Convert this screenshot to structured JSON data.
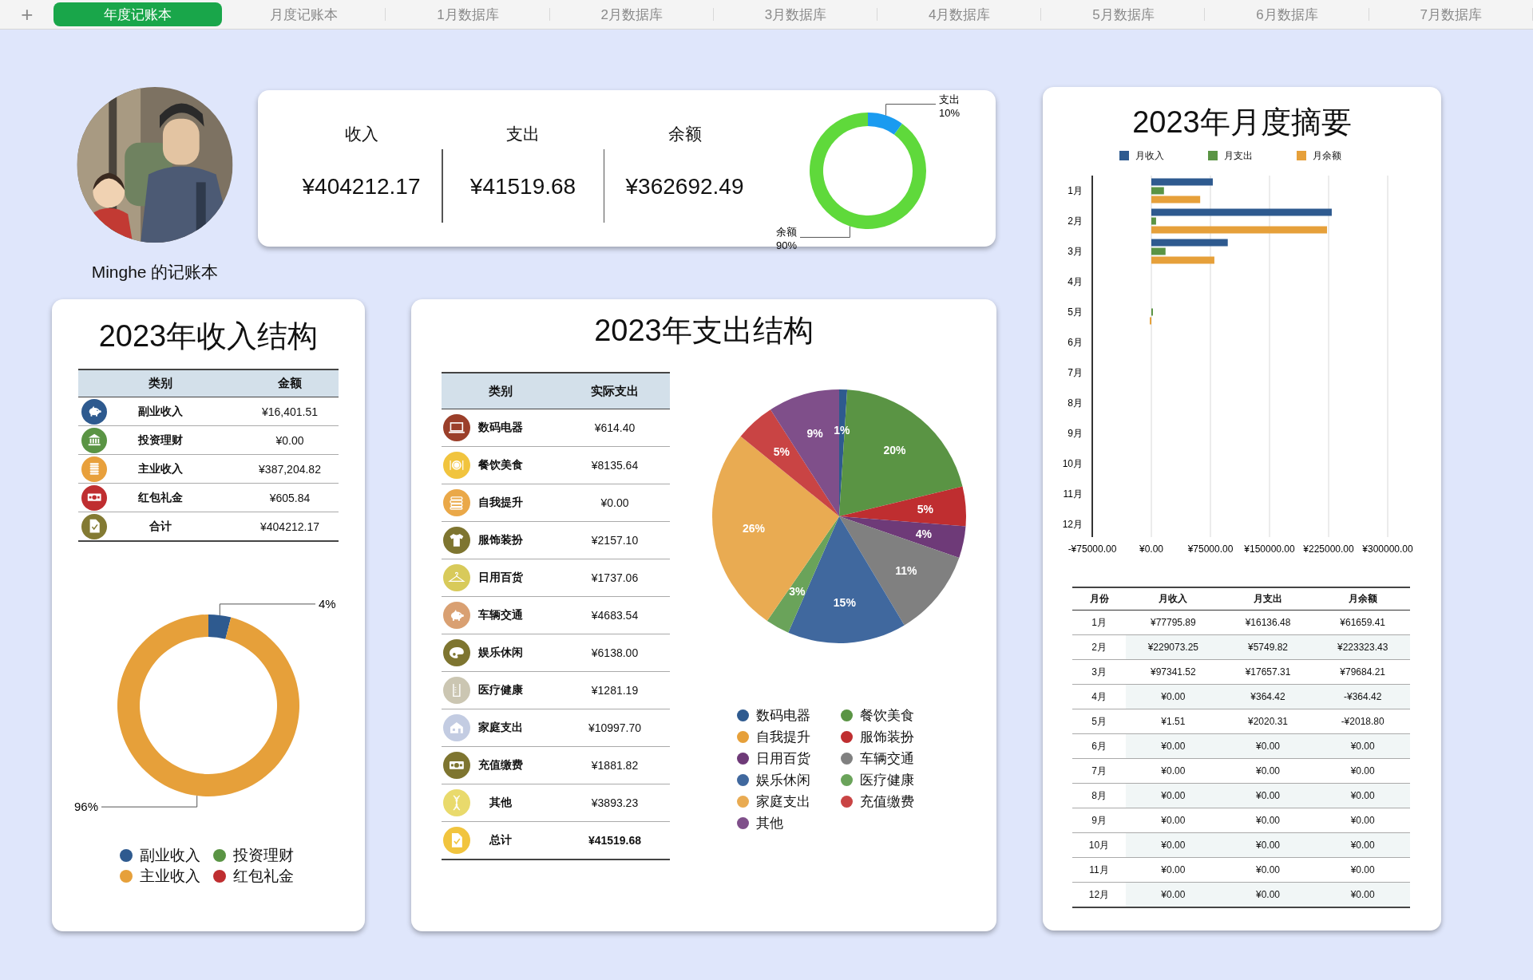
{
  "add_tab": "+",
  "tabs": [
    {
      "label": "年度记账本",
      "selected": true
    },
    {
      "label": "月度记账本",
      "selected": false
    },
    {
      "label": "1月数据库",
      "selected": false
    },
    {
      "label": "2月数据库",
      "selected": false
    },
    {
      "label": "3月数据库",
      "selected": false
    },
    {
      "label": "4月数据库",
      "selected": false
    },
    {
      "label": "5月数据库",
      "selected": false
    },
    {
      "label": "6月数据库",
      "selected": false
    },
    {
      "label": "7月数据库",
      "selected": false
    }
  ],
  "profile": {
    "name": "Minghe 的记账本"
  },
  "summary": {
    "stats": [
      {
        "label": "收入",
        "value": "¥404212.17"
      },
      {
        "label": "支出",
        "value": "¥41519.68"
      },
      {
        "label": "余额",
        "value": "¥362692.49"
      }
    ],
    "chart_data": {
      "type": "donut",
      "categories": [
        "支出",
        "余额"
      ],
      "values": [
        10,
        90
      ],
      "colors": [
        "#1a9bf0",
        "#5fd93b"
      ],
      "value_labels": [
        "10%",
        "90%"
      ]
    }
  },
  "income_structure": {
    "title": "2023年收入结构",
    "table": {
      "columns": [
        "类别",
        "金额"
      ],
      "rows": [
        {
          "category": "副业收入",
          "amount": "¥16,401.51",
          "color": "#2e5a8f"
        },
        {
          "category": "投资理财",
          "amount": "¥0.00",
          "color": "#5a9444"
        },
        {
          "category": "主业收入",
          "amount": "¥387,204.82",
          "color": "#e8a03c"
        },
        {
          "category": "红包礼金",
          "amount": "¥605.84",
          "color": "#bf2e30"
        }
      ],
      "total": {
        "category": "合计",
        "amount": "¥404212.17",
        "color": "#837a33"
      }
    },
    "chart_data": {
      "type": "donut",
      "values": [
        4,
        96
      ],
      "colors": [
        "#2e5a8f",
        "#e6a03a"
      ],
      "value_labels": [
        "4%",
        "96%"
      ]
    },
    "legend": [
      {
        "label": "副业收入",
        "color": "#2e5a8f"
      },
      {
        "label": "投资理财",
        "color": "#5a9444"
      },
      {
        "label": "主业收入",
        "color": "#e6a03a"
      },
      {
        "label": "红包礼金",
        "color": "#bf2e30"
      }
    ]
  },
  "expense_structure": {
    "title": "2023年支出结构",
    "table": {
      "columns": [
        "类别",
        "实际支出"
      ],
      "rows": [
        {
          "category": "数码电器",
          "amount": "¥614.40",
          "color": "#9b3f2a"
        },
        {
          "category": "餐饮美食",
          "amount": "¥8135.64",
          "color": "#f1c43e"
        },
        {
          "category": "自我提升",
          "amount": "¥0.00",
          "color": "#eaa848"
        },
        {
          "category": "服饰装扮",
          "amount": "¥2157.10",
          "color": "#7e7530"
        },
        {
          "category": "日用百货",
          "amount": "¥1737.06",
          "color": "#d8ca5a"
        },
        {
          "category": "车辆交通",
          "amount": "¥4683.54",
          "color": "#d9a072"
        },
        {
          "category": "娱乐休闲",
          "amount": "¥6138.00",
          "color": "#7e7530"
        },
        {
          "category": "医疗健康",
          "amount": "¥1281.19",
          "color": "#cbc6b2"
        },
        {
          "category": "家庭支出",
          "amount": "¥10997.70",
          "color": "#c3cce2"
        },
        {
          "category": "充值缴费",
          "amount": "¥1881.82",
          "color": "#7e7530"
        },
        {
          "category": "其他",
          "amount": "¥3893.23",
          "color": "#e9da6c"
        }
      ],
      "total": {
        "category": "总计",
        "amount": "¥41519.68",
        "color": "#f1c43e"
      }
    },
    "chart_data": {
      "type": "pie",
      "values": [
        1,
        20,
        5,
        4,
        11,
        15,
        3,
        26,
        5,
        9
      ],
      "colors": [
        "#2e5a8f",
        "#5a9444",
        "#bf2e30",
        "#6e3a78",
        "#808080",
        "#40689e",
        "#6aa35a",
        "#e9ab52",
        "#c94444",
        "#7f4f8a"
      ],
      "value_labels": [
        "1%",
        "20%",
        "5%",
        "4%",
        "11%",
        "15%",
        "3%",
        "26%",
        "5%",
        "9%"
      ]
    },
    "legend": [
      {
        "label": "数码电器",
        "color": "#2e5a8f"
      },
      {
        "label": "餐饮美食",
        "color": "#5a9444"
      },
      {
        "label": "自我提升",
        "color": "#e6a03a"
      },
      {
        "label": "服饰装扮",
        "color": "#bf2e30"
      },
      {
        "label": "日用百货",
        "color": "#6e3a78"
      },
      {
        "label": "车辆交通",
        "color": "#808080"
      },
      {
        "label": "娱乐休闲",
        "color": "#40689e"
      },
      {
        "label": "医疗健康",
        "color": "#6aa35a"
      },
      {
        "label": "家庭支出",
        "color": "#e9ab52"
      },
      {
        "label": "充值缴费",
        "color": "#c94444"
      },
      {
        "label": "其他",
        "color": "#7f4f8a"
      }
    ]
  },
  "monthly_summary": {
    "title": "2023年月度摘要",
    "chart_data": {
      "type": "bar",
      "orientation": "horizontal",
      "grid": true,
      "categories": [
        "1月",
        "2月",
        "3月",
        "4月",
        "5月",
        "6月",
        "7月",
        "8月",
        "9月",
        "10月",
        "11月",
        "12月"
      ],
      "series": [
        {
          "name": "月收入",
          "color": "#2e5a8f",
          "values": [
            78000,
            229000,
            97000,
            0,
            0,
            0,
            0,
            0,
            0,
            0,
            0,
            0
          ]
        },
        {
          "name": "月支出",
          "color": "#5a9444",
          "values": [
            16000,
            6000,
            18000,
            0,
            2000,
            0,
            0,
            0,
            0,
            0,
            0,
            0
          ]
        },
        {
          "name": "月余额",
          "color": "#e6a03a",
          "values": [
            62000,
            223000,
            80000,
            0,
            -2000,
            0,
            0,
            0,
            0,
            0,
            0,
            0
          ]
        }
      ],
      "xlim": [
        -75000,
        300000
      ],
      "xticks": [
        {
          "value": -75000,
          "label": "-¥75000.00"
        },
        {
          "value": 0,
          "label": "¥0.00"
        },
        {
          "value": 75000,
          "label": "¥75000.00"
        },
        {
          "value": 150000,
          "label": "¥150000.00"
        },
        {
          "value": 225000,
          "label": "¥225000.00"
        },
        {
          "value": 300000,
          "label": "¥300000.00"
        }
      ]
    },
    "table": {
      "columns": [
        "月份",
        "月收入",
        "月支出",
        "月余额"
      ],
      "rows": [
        {
          "month": "1月",
          "income": "¥77795.89",
          "expense": "¥16136.48",
          "balance": "¥61659.41"
        },
        {
          "month": "2月",
          "income": "¥229073.25",
          "expense": "¥5749.82",
          "balance": "¥223323.43"
        },
        {
          "month": "3月",
          "income": "¥97341.52",
          "expense": "¥17657.31",
          "balance": "¥79684.21"
        },
        {
          "month": "4月",
          "income": "¥0.00",
          "expense": "¥364.42",
          "balance": "-¥364.42"
        },
        {
          "month": "5月",
          "income": "¥1.51",
          "expense": "¥2020.31",
          "balance": "-¥2018.80"
        },
        {
          "month": "6月",
          "income": "¥0.00",
          "expense": "¥0.00",
          "balance": "¥0.00"
        },
        {
          "month": "7月",
          "income": "¥0.00",
          "expense": "¥0.00",
          "balance": "¥0.00"
        },
        {
          "month": "8月",
          "income": "¥0.00",
          "expense": "¥0.00",
          "balance": "¥0.00"
        },
        {
          "month": "9月",
          "income": "¥0.00",
          "expense": "¥0.00",
          "balance": "¥0.00"
        },
        {
          "month": "10月",
          "income": "¥0.00",
          "expense": "¥0.00",
          "balance": "¥0.00"
        },
        {
          "month": "11月",
          "income": "¥0.00",
          "expense": "¥0.00",
          "balance": "¥0.00"
        },
        {
          "month": "12月",
          "income": "¥0.00",
          "expense": "¥0.00",
          "balance": "¥0.00"
        }
      ]
    }
  }
}
